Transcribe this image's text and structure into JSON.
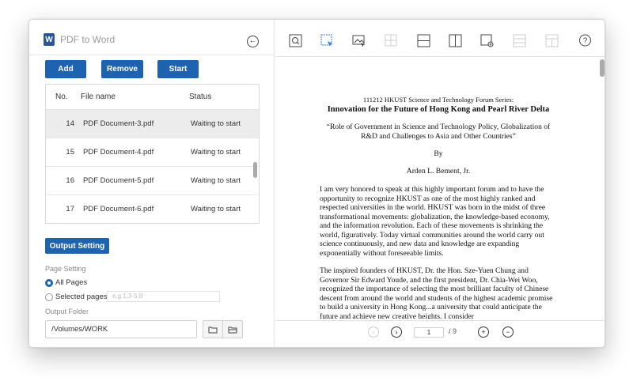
{
  "app": {
    "title": "PDF to Word",
    "word_icon": "W"
  },
  "buttons": {
    "add": "Add",
    "remove": "Remove",
    "start": "Start",
    "output_setting": "Output Setting"
  },
  "table": {
    "headers": {
      "no": "No.",
      "name": "File name",
      "status": "Status"
    },
    "rows": [
      {
        "no": "14",
        "name": "PDF Document-3.pdf",
        "status": "Waiting to start",
        "selected": true
      },
      {
        "no": "15",
        "name": "PDF Document-4.pdf",
        "status": "Waiting to start",
        "selected": false
      },
      {
        "no": "16",
        "name": "PDF Document-5.pdf",
        "status": "Waiting to start",
        "selected": false
      },
      {
        "no": "17",
        "name": "PDF Document-6.pdf",
        "status": "Waiting to start",
        "selected": false
      }
    ]
  },
  "page_setting": {
    "label": "Page Setting",
    "all_pages": "All Pages",
    "selected_pages": "Selected pages",
    "pages_placeholder": "e.g.1,3-5,8"
  },
  "output_folder": {
    "label": "Output Folder",
    "value": "/Volumes/WORK"
  },
  "viewer": {
    "current_page": "1",
    "total_pages": "/ 9",
    "doc": {
      "header": "111212 HKUST Science and Technology Forum Series:",
      "title": "Innovation for the Future of Hong Kong and Pearl River Delta",
      "subtitle": "“Role of Government in Science and Technology Policy, Globalization of R&D and Challenges to Asia and Other Countries”",
      "by": "By",
      "author": "Arden L. Bement, Jr.",
      "para1": "I am very honored to speak at this highly important forum and to have the opportunity to recognize HKUST as one of the most highly ranked and respected universities in the world.  HKUST was born in the midst of three transformational movements: globalization, the knowledge-based economy, and the information revolution. Each of these movements is shrinking the world, figuratively. Today virtual communities around the world carry out science continuously, and new data and knowledge are expanding exponentially without foreseeable limits.",
      "para2": "The inspired founders of HKUST, Dr. the Hon. Sze-Yuen Chung and Governor Sir Edward Youde, and the first president, Dr. Chia-Wei Woo, recognized the importance of selecting the most brilliant faculty of Chinese descent from around the world and students of the highest academic promise to build a university in Hong Kong...a university that could anticipate the future and achieve new creative heights. I consider"
    }
  }
}
